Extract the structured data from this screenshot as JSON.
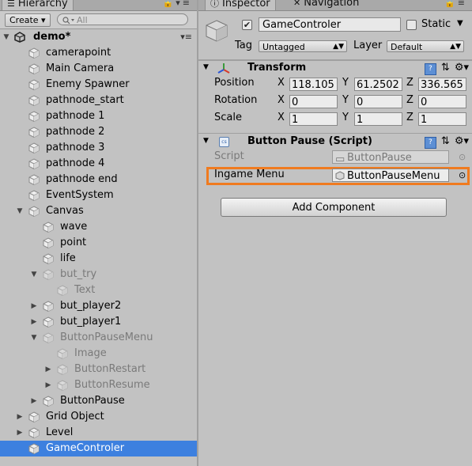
{
  "hierarchy": {
    "tab_label": "Hierarchy",
    "create_label": "Create",
    "search_placeholder": "All",
    "scene_name": "demo*",
    "items": [
      {
        "label": "camerapoint"
      },
      {
        "label": "Main Camera"
      },
      {
        "label": "Enemy Spawner"
      },
      {
        "label": "pathnode_start"
      },
      {
        "label": "pathnode 1"
      },
      {
        "label": "pathnode 2"
      },
      {
        "label": "pathnode 3"
      },
      {
        "label": "pathnode 4"
      },
      {
        "label": "pathnode end"
      },
      {
        "label": "EventSystem"
      },
      {
        "label": "Canvas",
        "expanded": true
      },
      {
        "label": "wave"
      },
      {
        "label": "point"
      },
      {
        "label": "life"
      },
      {
        "label": "but_try",
        "expanded": true,
        "inactive": true
      },
      {
        "label": "Text",
        "inactive": true
      },
      {
        "label": "but_player2",
        "collapsed": true
      },
      {
        "label": "but_player1",
        "collapsed": true
      },
      {
        "label": "ButtonPauseMenu",
        "expanded": true,
        "inactive": true
      },
      {
        "label": "Image",
        "inactive": true
      },
      {
        "label": "ButtonRestart",
        "collapsed": true,
        "inactive": true
      },
      {
        "label": "ButtonResume",
        "collapsed": true,
        "inactive": true
      },
      {
        "label": "ButtonPause",
        "collapsed": true
      },
      {
        "label": "Grid Object",
        "collapsed": true
      },
      {
        "label": "Level",
        "collapsed": true
      },
      {
        "label": "GameControler",
        "selected": true
      }
    ]
  },
  "inspector": {
    "tab_label": "Inspector",
    "nav_tab_label": "Navigation",
    "object_name": "GameControler",
    "active_checked": true,
    "static_label": "Static",
    "tag_label": "Tag",
    "tag_value": "Untagged",
    "layer_label": "Layer",
    "layer_value": "Default",
    "transform": {
      "title": "Transform",
      "position_label": "Position",
      "rotation_label": "Rotation",
      "scale_label": "Scale",
      "axis_x": "X",
      "axis_y": "Y",
      "axis_z": "Z",
      "position": {
        "x": "118.105",
        "y": "61.2502",
        "z": "336.565"
      },
      "rotation": {
        "x": "0",
        "y": "0",
        "z": "0"
      },
      "scale": {
        "x": "1",
        "y": "1",
        "z": "1"
      }
    },
    "script_component": {
      "title": "Button Pause (Script)",
      "script_label": "Script",
      "script_value": "ButtonPause",
      "menu_label": "Ingame Menu",
      "menu_value": "ButtonPauseMenu"
    },
    "add_component_label": "Add Component"
  },
  "colors": {
    "selection": "#3d80df",
    "highlight": "#f07b1f",
    "panel": "#c2c2c2"
  }
}
